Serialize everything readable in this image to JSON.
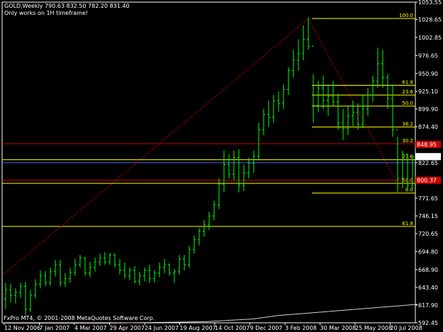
{
  "header": {
    "title": "GOLD,Weekly  790.63 832.50 782.20 831.40",
    "note": "Only works on 1H timeframe!"
  },
  "footer": {
    "copyright": "FxPro MT4, © 2001-2008 MetaQuotes Software Corp."
  },
  "colors": {
    "background": "#000000",
    "bar": "#00ff00",
    "fib": "#ffff00",
    "trend": "#cc0000",
    "ma": "#ddcccc",
    "grid": "#ffffff"
  },
  "chart_data": {
    "type": "bar",
    "symbol": "GOLD",
    "timeframe": "Weekly",
    "ylim": [
      592.45,
      1053.55
    ],
    "y_ticks": [
      1053.55,
      1028.65,
      1002.85,
      976.65,
      950.9,
      925.1,
      899.9,
      874.4,
      848.6,
      822.65,
      797.55,
      771.65,
      746.15,
      720.65,
      694.8,
      668.9,
      643.4,
      617.9,
      592.45
    ],
    "x_ticks": [
      "12 Nov 2006",
      "7 Jan 2007",
      "4 Mar 2007",
      "29 Apr 2007",
      "24 Jun 2007",
      "19 Aug 2007",
      "14 Oct 2007",
      "9 Dec 2007",
      "3 Feb 2008",
      "30 Mar 2008",
      "25 May 2008",
      "20 Jul 2008"
    ],
    "series": [
      {
        "values": [
          [
            627,
            650,
            612,
            640
          ],
          [
            640,
            648,
            622,
            632
          ],
          [
            632,
            642,
            620,
            636
          ],
          [
            636,
            650,
            628,
            645
          ],
          [
            645,
            651,
            604,
            612
          ],
          [
            612,
            640,
            608,
            632
          ],
          [
            632,
            655,
            628,
            648
          ],
          [
            648,
            668,
            642,
            660
          ],
          [
            660,
            667,
            645,
            650
          ],
          [
            650,
            672,
            646,
            666
          ],
          [
            666,
            683,
            659,
            676
          ],
          [
            676,
            683,
            645,
            650
          ],
          [
            650,
            664,
            644,
            656
          ],
          [
            656,
            671,
            650,
            665
          ],
          [
            665,
            684,
            660,
            676
          ],
          [
            676,
            690,
            672,
            686
          ],
          [
            686,
            687,
            660,
            664
          ],
          [
            664,
            680,
            658,
            672
          ],
          [
            672,
            686,
            666,
            680
          ],
          [
            680,
            692,
            674,
            686
          ],
          [
            686,
            694,
            676,
            680
          ],
          [
            680,
            693,
            676,
            690
          ],
          [
            690,
            692,
            672,
            676
          ],
          [
            676,
            684,
            662,
            668
          ],
          [
            668,
            679,
            656,
            660
          ],
          [
            660,
            672,
            654,
            668
          ],
          [
            668,
            674,
            649,
            652
          ],
          [
            652,
            666,
            646,
            660
          ],
          [
            660,
            672,
            652,
            668
          ],
          [
            668,
            676,
            650,
            656
          ],
          [
            656,
            668,
            650,
            664
          ],
          [
            664,
            679,
            658,
            672
          ],
          [
            672,
            684,
            664,
            676
          ],
          [
            676,
            678,
            660,
            664
          ],
          [
            664,
            670,
            650,
            666
          ],
          [
            666,
            690,
            662,
            684
          ],
          [
            684,
            690,
            668,
            676
          ],
          [
            676,
            703,
            672,
            698
          ],
          [
            698,
            718,
            692,
            712
          ],
          [
            712,
            729,
            704,
            724
          ],
          [
            724,
            740,
            716,
            734
          ],
          [
            734,
            752,
            726,
            746
          ],
          [
            746,
            768,
            740,
            762
          ],
          [
            762,
            800,
            756,
            792
          ],
          [
            792,
            840,
            780,
            820
          ],
          [
            820,
            835,
            800,
            806
          ],
          [
            806,
            840,
            798,
            830
          ],
          [
            830,
            842,
            780,
            790
          ],
          [
            790,
            820,
            782,
            808
          ],
          [
            808,
            830,
            800,
            822
          ],
          [
            822,
            840,
            808,
            832
          ],
          [
            832,
            880,
            826,
            870
          ],
          [
            870,
            900,
            862,
            892
          ],
          [
            892,
            912,
            874,
            888
          ],
          [
            888,
            920,
            880,
            912
          ],
          [
            912,
            925,
            896,
            908
          ],
          [
            908,
            935,
            900,
            928
          ],
          [
            928,
            960,
            920,
            955
          ],
          [
            955,
            985,
            945,
            970
          ],
          [
            970,
            1000,
            955,
            980
          ],
          [
            980,
            1020,
            970,
            1000
          ],
          [
            1000,
            1032,
            985,
            990
          ],
          [
            990,
            950,
            880,
            905
          ],
          [
            905,
            940,
            895,
            930
          ],
          [
            930,
            948,
            900,
            912
          ],
          [
            912,
            935,
            890,
            918
          ],
          [
            918,
            940,
            905,
            910
          ],
          [
            910,
            922,
            870,
            880
          ],
          [
            880,
            900,
            855,
            872
          ],
          [
            872,
            905,
            862,
            890
          ],
          [
            890,
            912,
            875,
            895
          ],
          [
            895,
            908,
            870,
            878
          ],
          [
            878,
            920,
            872,
            900
          ],
          [
            900,
            930,
            890,
            920
          ],
          [
            920,
            948,
            910,
            940
          ],
          [
            940,
            988,
            930,
            965
          ],
          [
            965,
            985,
            930,
            945
          ],
          [
            945,
            950,
            900,
            915
          ],
          [
            915,
            935,
            860,
            870
          ],
          [
            870,
            860,
            780,
            800
          ],
          [
            800,
            840,
            786,
            835
          ],
          [
            835,
            835,
            782,
            790
          ],
          [
            790,
            832.5,
            782.2,
            831.4
          ]
        ]
      },
      {
        "values": [
          [
            0,
            592
          ],
          [
            20,
            592
          ],
          [
            40,
            594
          ],
          [
            50,
            598
          ],
          [
            55,
            603
          ],
          [
            62,
            607
          ],
          [
            69,
            611
          ],
          [
            76,
            615
          ],
          [
            83,
            619
          ]
        ]
      }
    ],
    "fib_levels": [
      {
        "label": "100.0",
        "price": 1030.0
      },
      {
        "label": "61.8",
        "price": 934.0
      },
      {
        "label": "23.6",
        "price": 920.0
      },
      {
        "label": "50.0",
        "price": 904.0
      },
      {
        "label": "38.2",
        "price": 874.0
      },
      {
        "label": "30.2",
        "price": 850.0
      },
      {
        "label": "23.6",
        "price": 827.0
      },
      {
        "label": "50.0",
        "price": 793.0
      },
      {
        "label": "0.0",
        "price": 779.0
      },
      {
        "label": "61.8",
        "price": 731.0
      }
    ],
    "red_lines": [
      850.0,
      797.37
    ],
    "blue_line": 822.65,
    "price_labels": [
      {
        "text": "831.40",
        "price": 831.4
      },
      {
        "text": "848.95",
        "price": 848.95
      },
      {
        "text": "800.37",
        "price": 797.37
      }
    ]
  }
}
